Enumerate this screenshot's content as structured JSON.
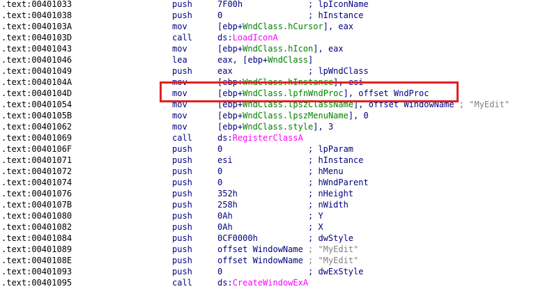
{
  "colors": {
    "address": "#000000",
    "code": "#000080",
    "struct_name": "#008000",
    "api_name": "#ff00ff",
    "string_comment": "#808080",
    "highlight_box": "#e02020"
  },
  "rows": [
    {
      "addr": ".text:00401033",
      "mn": "push",
      "opd": [
        {
          "t": "7F00h",
          "c": "reg"
        }
      ],
      "cm": "; lpIconName"
    },
    {
      "addr": ".text:00401038",
      "mn": "push",
      "opd": [
        {
          "t": "0",
          "c": "reg"
        }
      ],
      "cm": "; hInstance"
    },
    {
      "addr": ".text:0040103A",
      "mn": "mov",
      "opd": [
        {
          "t": "[ebp+",
          "c": "reg"
        },
        {
          "t": "WndClass",
          "c": "struct"
        },
        {
          "t": ".hCursor",
          "c": "struct"
        },
        {
          "t": "], eax",
          "c": "reg"
        }
      ],
      "cm": ""
    },
    {
      "addr": ".text:0040103D",
      "mn": "call",
      "opd": [
        {
          "t": "ds:",
          "c": "reg"
        },
        {
          "t": "LoadIconA",
          "c": "api"
        }
      ],
      "cm": ""
    },
    {
      "addr": ".text:00401043",
      "mn": "mov",
      "opd": [
        {
          "t": "[ebp+",
          "c": "reg"
        },
        {
          "t": "WndClass",
          "c": "struct"
        },
        {
          "t": ".hIcon",
          "c": "struct"
        },
        {
          "t": "], eax",
          "c": "reg"
        }
      ],
      "cm": ""
    },
    {
      "addr": ".text:00401046",
      "mn": "lea",
      "opd": [
        {
          "t": "eax, [ebp+",
          "c": "reg"
        },
        {
          "t": "WndClass",
          "c": "struct"
        },
        {
          "t": "]",
          "c": "reg"
        }
      ],
      "cm": ""
    },
    {
      "addr": ".text:00401049",
      "mn": "push",
      "opd": [
        {
          "t": "eax",
          "c": "reg"
        }
      ],
      "cm": "; lpWndClass"
    },
    {
      "addr": ".text:0040104A",
      "mn": "mov",
      "opd": [
        {
          "t": "[ebp+",
          "c": "reg"
        },
        {
          "t": "WndClass",
          "c": "struct"
        },
        {
          "t": ".hInstance",
          "c": "struct"
        },
        {
          "t": "], esi",
          "c": "reg"
        }
      ],
      "cm": ""
    },
    {
      "addr": ".text:0040104D",
      "mn": "mov",
      "opd": [
        {
          "t": "[ebp+",
          "c": "reg"
        },
        {
          "t": "WndClass",
          "c": "struct"
        },
        {
          "t": ".lpfnWndProc",
          "c": "struct"
        },
        {
          "t": "], offset WndProc",
          "c": "reg"
        }
      ],
      "cm": ""
    },
    {
      "addr": ".text:00401054",
      "mn": "mov",
      "opd": [
        {
          "t": "[ebp+",
          "c": "reg"
        },
        {
          "t": "WndClass",
          "c": "struct"
        },
        {
          "t": ".lpszClassName",
          "c": "struct"
        },
        {
          "t": "], offset WindowName ",
          "c": "reg"
        },
        {
          "t": "; \"MyEdit\"",
          "c": "str"
        }
      ],
      "cm": ""
    },
    {
      "addr": ".text:0040105B",
      "mn": "mov",
      "opd": [
        {
          "t": "[ebp+",
          "c": "reg"
        },
        {
          "t": "WndClass",
          "c": "struct"
        },
        {
          "t": ".lpszMenuName",
          "c": "struct"
        },
        {
          "t": "], 0",
          "c": "reg"
        }
      ],
      "cm": ""
    },
    {
      "addr": ".text:00401062",
      "mn": "mov",
      "opd": [
        {
          "t": "[ebp+",
          "c": "reg"
        },
        {
          "t": "WndClass",
          "c": "struct"
        },
        {
          "t": ".style",
          "c": "struct"
        },
        {
          "t": "], 3",
          "c": "reg"
        }
      ],
      "cm": ""
    },
    {
      "addr": ".text:00401069",
      "mn": "call",
      "opd": [
        {
          "t": "ds:",
          "c": "reg"
        },
        {
          "t": "RegisterClassA",
          "c": "api"
        }
      ],
      "cm": ""
    },
    {
      "addr": ".text:0040106F",
      "mn": "push",
      "opd": [
        {
          "t": "0",
          "c": "reg"
        }
      ],
      "cm": "; lpParam"
    },
    {
      "addr": ".text:00401071",
      "mn": "push",
      "opd": [
        {
          "t": "esi",
          "c": "reg"
        }
      ],
      "cm": "; hInstance"
    },
    {
      "addr": ".text:00401072",
      "mn": "push",
      "opd": [
        {
          "t": "0",
          "c": "reg"
        }
      ],
      "cm": "; hMenu"
    },
    {
      "addr": ".text:00401074",
      "mn": "push",
      "opd": [
        {
          "t": "0",
          "c": "reg"
        }
      ],
      "cm": "; hWndParent"
    },
    {
      "addr": ".text:00401076",
      "mn": "push",
      "opd": [
        {
          "t": "352h",
          "c": "reg"
        }
      ],
      "cm": "; nHeight"
    },
    {
      "addr": ".text:0040107B",
      "mn": "push",
      "opd": [
        {
          "t": "258h",
          "c": "reg"
        }
      ],
      "cm": "; nWidth"
    },
    {
      "addr": ".text:00401080",
      "mn": "push",
      "opd": [
        {
          "t": "0Ah",
          "c": "reg"
        }
      ],
      "cm": "; Y"
    },
    {
      "addr": ".text:00401082",
      "mn": "push",
      "opd": [
        {
          "t": "0Ah",
          "c": "reg"
        }
      ],
      "cm": "; X"
    },
    {
      "addr": ".text:00401084",
      "mn": "push",
      "opd": [
        {
          "t": "0CF0000h",
          "c": "reg"
        }
      ],
      "cm": "; dwStyle"
    },
    {
      "addr": ".text:00401089",
      "mn": "push",
      "opd": [
        {
          "t": "offset WindowName ",
          "c": "reg"
        },
        {
          "t": "; \"MyEdit\"",
          "c": "str"
        }
      ],
      "cm": ""
    },
    {
      "addr": ".text:0040108E",
      "mn": "push",
      "opd": [
        {
          "t": "offset WindowName ",
          "c": "reg"
        },
        {
          "t": "; \"MyEdit\"",
          "c": "str"
        }
      ],
      "cm": ""
    },
    {
      "addr": ".text:00401093",
      "mn": "push",
      "opd": [
        {
          "t": "0",
          "c": "reg"
        }
      ],
      "cm": "; dwExStyle"
    },
    {
      "addr": ".text:00401095",
      "mn": "call",
      "opd": [
        {
          "t": "ds:",
          "c": "reg"
        },
        {
          "t": "CreateWindowExA",
          "c": "api"
        }
      ],
      "cm": ""
    }
  ]
}
